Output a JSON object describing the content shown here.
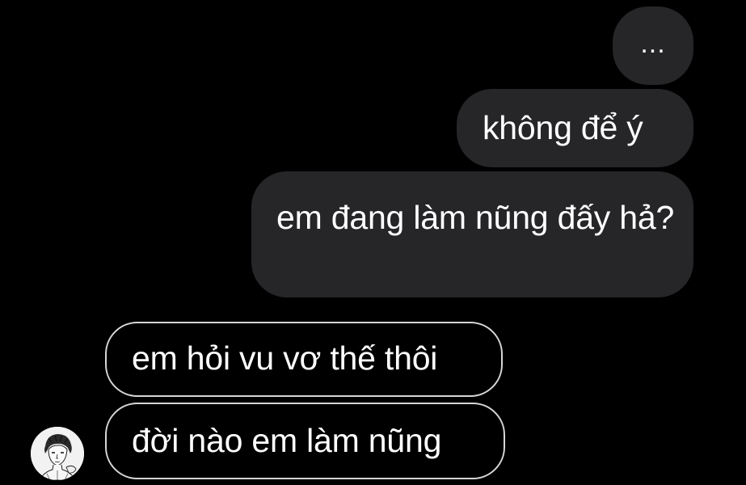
{
  "conversation": {
    "sent": [
      {
        "text": "..."
      },
      {
        "text": "không để ý"
      },
      {
        "text": "em đang làm nũng đấy hả?"
      }
    ],
    "received": [
      {
        "text": "em hỏi vu vơ thế thôi"
      },
      {
        "text": "đời nào em làm nũng"
      }
    ],
    "contact_avatar": {
      "icon": "sketch-portrait-avatar"
    }
  },
  "colors": {
    "background": "#000000",
    "sent_bubble": "#262528",
    "received_border": "#d6d6d6",
    "text": "#ffffff"
  }
}
